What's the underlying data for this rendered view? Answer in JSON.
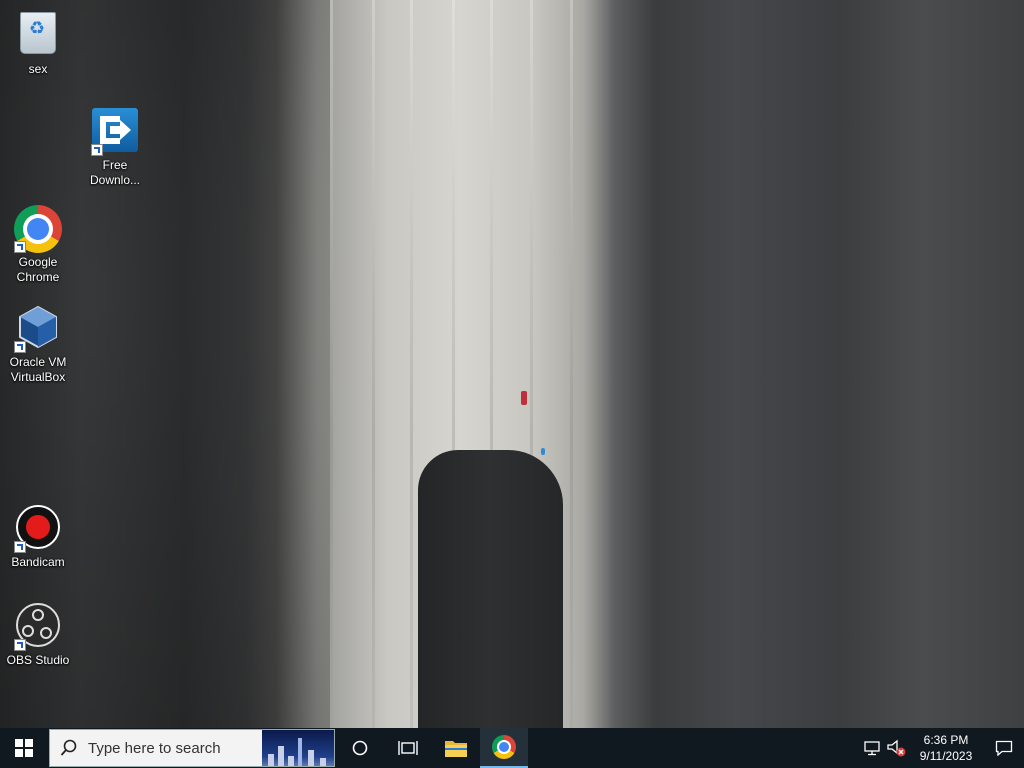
{
  "desktop": {
    "icons": [
      {
        "label": "sex",
        "icon": "recycle-bin-icon"
      },
      {
        "label": "Free Downlo...",
        "icon": "free-download-manager-icon"
      },
      {
        "label": "Google Chrome",
        "icon": "chrome-icon"
      },
      {
        "label": "Oracle VM VirtualBox",
        "icon": "virtualbox-icon"
      },
      {
        "label": "Bandicam",
        "icon": "bandicam-icon"
      },
      {
        "label": "OBS Studio",
        "icon": "obs-icon"
      }
    ]
  },
  "taskbar": {
    "search_placeholder": "Type here to search",
    "pinned": [
      {
        "name": "cortana-icon"
      },
      {
        "name": "task-view-icon"
      },
      {
        "name": "file-explorer-icon"
      },
      {
        "name": "chrome-icon"
      }
    ],
    "tray": {
      "network_icon": "network-icon",
      "volume_icon": "volume-muted-icon",
      "time": "6:36 PM",
      "date": "9/11/2023",
      "notification_icon": "notification-icon"
    }
  },
  "colors": {
    "taskbar_bg": "#101820",
    "windows_accent": "#ffffff"
  }
}
